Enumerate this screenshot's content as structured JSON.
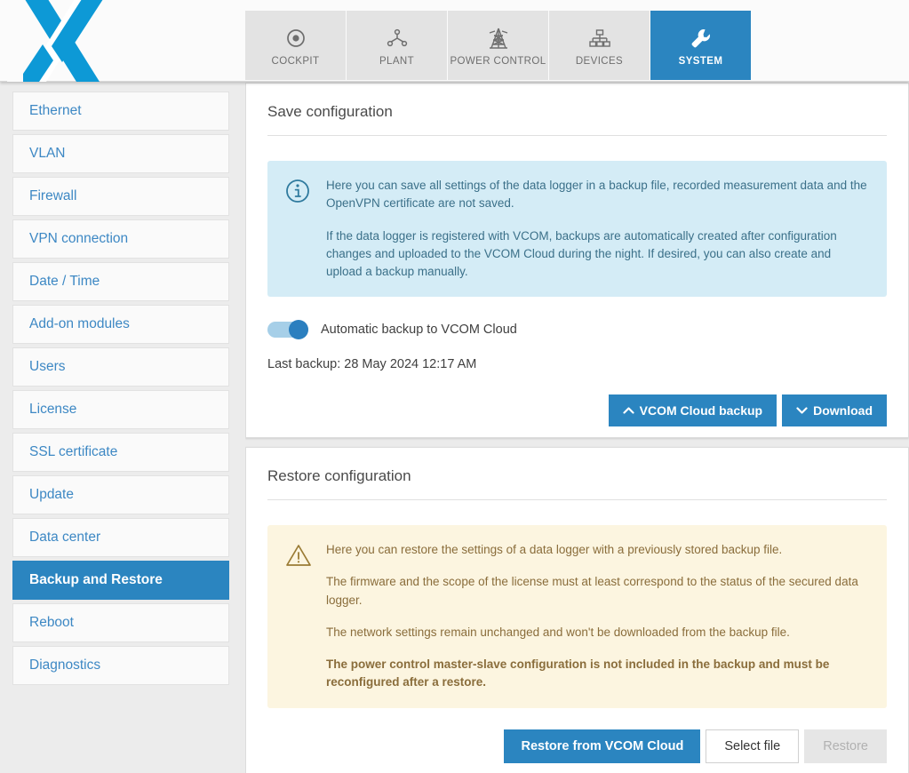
{
  "header": {
    "logo_alt": "X logo",
    "tabs": [
      {
        "label": "COCKPIT",
        "icon": "target-icon",
        "active": false
      },
      {
        "label": "PLANT",
        "icon": "plant-network-icon",
        "active": false
      },
      {
        "label": "POWER CONTROL",
        "icon": "power-pylon-icon",
        "active": false
      },
      {
        "label": "DEVICES",
        "icon": "devices-tree-icon",
        "active": false
      },
      {
        "label": "SYSTEM",
        "icon": "wrench-icon",
        "active": true
      }
    ]
  },
  "sidebar": {
    "items": [
      {
        "label": "Ethernet",
        "active": false
      },
      {
        "label": "VLAN",
        "active": false
      },
      {
        "label": "Firewall",
        "active": false
      },
      {
        "label": "VPN connection",
        "active": false
      },
      {
        "label": "Date / Time",
        "active": false
      },
      {
        "label": "Add-on modules",
        "active": false
      },
      {
        "label": "Users",
        "active": false
      },
      {
        "label": "License",
        "active": false
      },
      {
        "label": "SSL certificate",
        "active": false
      },
      {
        "label": "Update",
        "active": false
      },
      {
        "label": "Data center",
        "active": false
      },
      {
        "label": "Backup and Restore",
        "active": true
      },
      {
        "label": "Reboot",
        "active": false
      },
      {
        "label": "Diagnostics",
        "active": false
      }
    ]
  },
  "save_configuration": {
    "title": "Save configuration",
    "info": {
      "icon": "info-circle-icon",
      "paragraphs": [
        "Here you can save all settings of the data logger in a backup file, recorded measurement data and the OpenVPN certificate are not saved.",
        "If the data logger is registered with VCOM, backups are automatically created after configuration changes and uploaded to the VCOM Cloud during the night. If desired, you can also create and upload a backup manually."
      ]
    },
    "toggle": {
      "label": "Automatic backup to VCOM Cloud",
      "state": "on"
    },
    "last_backup": "Last backup: 28 May 2024 12:17 AM",
    "buttons": {
      "cloud_backup": "VCOM Cloud backup",
      "cloud_backup_icon": "chevron-up-icon",
      "download": "Download",
      "download_icon": "chevron-down-icon"
    }
  },
  "restore_configuration": {
    "title": "Restore configuration",
    "warning": {
      "icon": "warning-triangle-icon",
      "paragraphs": [
        "Here you can restore the settings of a data logger with a previously stored backup file.",
        "The firmware and the scope of the license must at least correspond to the status of the secured data logger.",
        "The network settings remain unchanged and won't be downloaded from the backup file."
      ],
      "bold_paragraph": "The power control master-slave configuration is not included in the backup and must be reconfigured after a restore."
    },
    "buttons": {
      "restore_from_cloud": "Restore from VCOM Cloud",
      "select_file": "Select file",
      "restore": "Restore"
    }
  },
  "colors": {
    "accent": "#2b85c0",
    "logo_blue": "#0d99d6",
    "info_bg": "#d4ecf6",
    "warn_bg": "#fcf5e0",
    "link": "#3d88c4"
  }
}
